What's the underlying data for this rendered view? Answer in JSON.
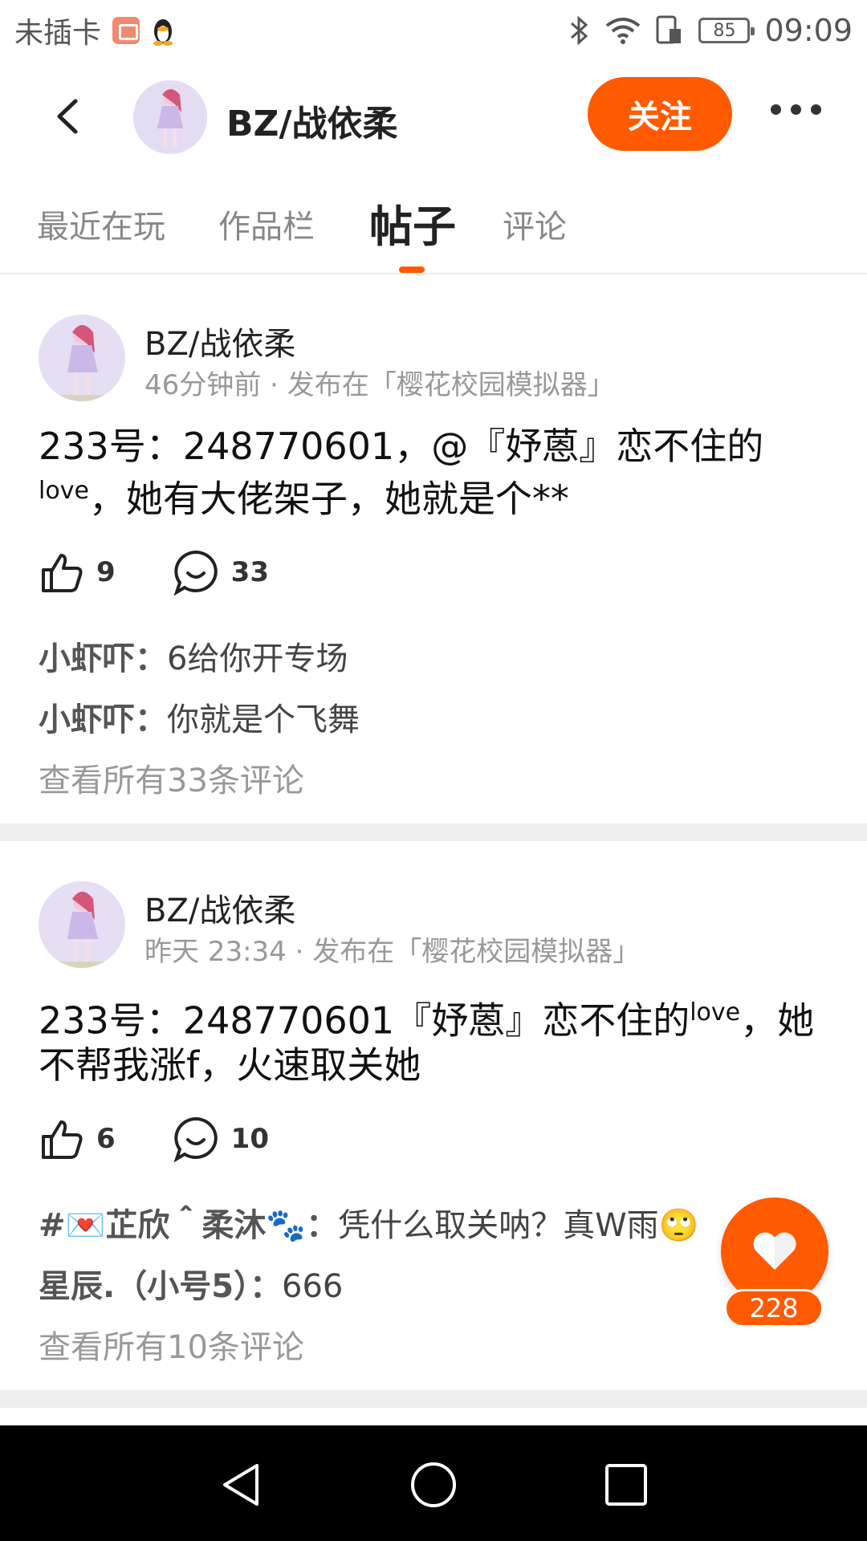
{
  "status_bar": {
    "carrier": "未插卡",
    "battery": "85",
    "time": "09:09"
  },
  "header": {
    "title": "BZ/战依柔",
    "follow_label": "关注"
  },
  "tabs": [
    {
      "label": "最近在玩"
    },
    {
      "label": "作品栏"
    },
    {
      "label": "帖子"
    },
    {
      "label": "评论"
    }
  ],
  "posts": [
    {
      "author": "BZ/战依柔",
      "time": "46分钟前",
      "published_in": "发布在「樱花校园模拟器」",
      "content_main": "233号：248770601，@『妤蒽』恋不住的",
      "content_sup": "love",
      "content_tail": "，她有大佬架子，她就是个**",
      "likes": "9",
      "comments": "33",
      "comment_list": [
        {
          "name": "小虾吓：",
          "text": "6给你开专场"
        },
        {
          "name": "小虾吓：",
          "text": "你就是个飞舞"
        }
      ],
      "view_all": "查看所有33条评论"
    },
    {
      "author": "BZ/战依柔",
      "time": "昨天 23:34",
      "published_in": "发布在「樱花校园模拟器」",
      "content_main": "233号：248770601『妤蒽』恋不住的",
      "content_sup": "love",
      "content_tail": "，她不帮我涨f，火速取关她",
      "likes": "6",
      "comments": "10",
      "comment_list": [
        {
          "name": "#💌芷欣＾柔沐🐾：",
          "text": "凭什么取关呐？真W雨🙄"
        },
        {
          "name": "星辰.（小号5）：",
          "text": "666"
        }
      ],
      "view_all": "查看所有10条评论"
    }
  ],
  "fab": {
    "count": "228"
  },
  "colors": {
    "accent": "#ff5a00",
    "text_secondary": "#999999"
  }
}
